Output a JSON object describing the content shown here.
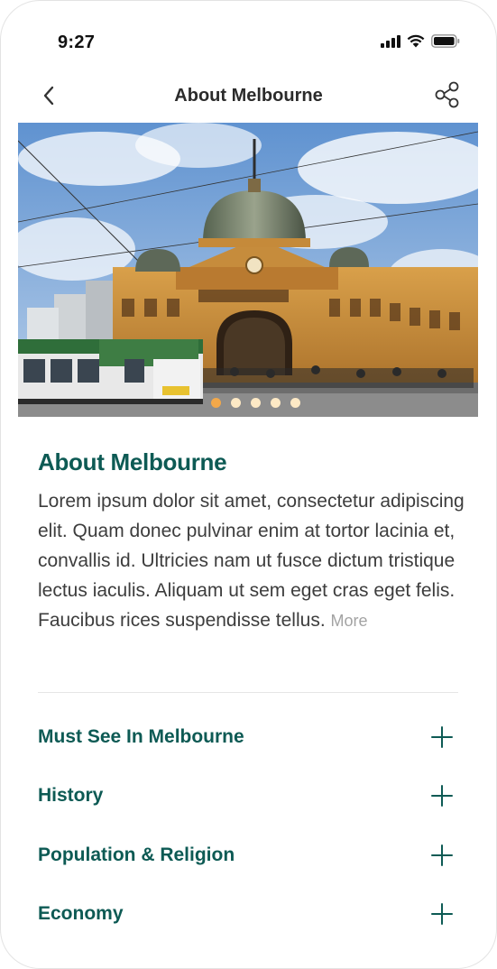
{
  "status_bar": {
    "time": "9:27",
    "icons": [
      "signal-icon",
      "wifi-icon",
      "battery-icon"
    ]
  },
  "header": {
    "title": "About Melbourne",
    "back_icon": "chevron-left-icon",
    "share_icon": "share-icon"
  },
  "hero": {
    "slide_count": 5,
    "active_index": 0,
    "active_color": "#f2a84a",
    "inactive_color": "#fde9c5"
  },
  "about": {
    "heading": "About Melbourne",
    "body": "Lorem ipsum dolor sit amet, consectetur adipiscing elit. Quam donec pulvinar enim at tortor lacinia et, convallis id. Ultricies nam ut fusce dictum tristique lectus iaculis. Aliquam ut sem eget cras eget felis. Faucibus rices suspendisse tellus.",
    "more_label": "More"
  },
  "sections": [
    {
      "label": "Must See In Melbourne",
      "icon": "plus-icon"
    },
    {
      "label": "History",
      "icon": "plus-icon"
    },
    {
      "label": "Population & Religion",
      "icon": "plus-icon"
    },
    {
      "label": "Economy",
      "icon": "plus-icon"
    }
  ],
  "colors": {
    "accent": "#0d5a54",
    "body_text": "#3d3d3d",
    "muted": "#a3a3a3"
  }
}
